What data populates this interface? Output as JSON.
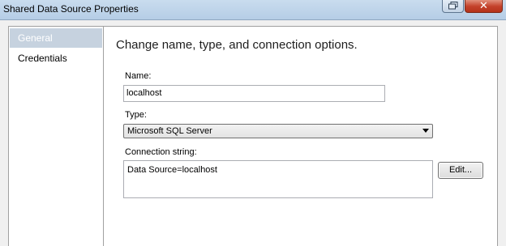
{
  "window": {
    "title": "Shared Data Source Properties",
    "close_glyph": "✕"
  },
  "sidebar": {
    "items": [
      {
        "label": "General",
        "selected": true
      },
      {
        "label": "Credentials",
        "selected": false
      }
    ]
  },
  "main": {
    "heading": "Change name, type, and connection options.",
    "name": {
      "label": "Name:",
      "value": "localhost"
    },
    "type": {
      "label": "Type:",
      "selected": "Microsoft SQL Server"
    },
    "connection": {
      "label": "Connection string:",
      "value": "Data Source=localhost"
    },
    "edit_button": "Edit..."
  },
  "colors": {
    "selected_item_bg": "#c6d2df",
    "close_button": "#c4422b",
    "titlebar": "#c9dcee"
  },
  "icons": {
    "restore": "restore-icon",
    "close": "close-icon",
    "dropdown": "chevron-down-icon"
  }
}
